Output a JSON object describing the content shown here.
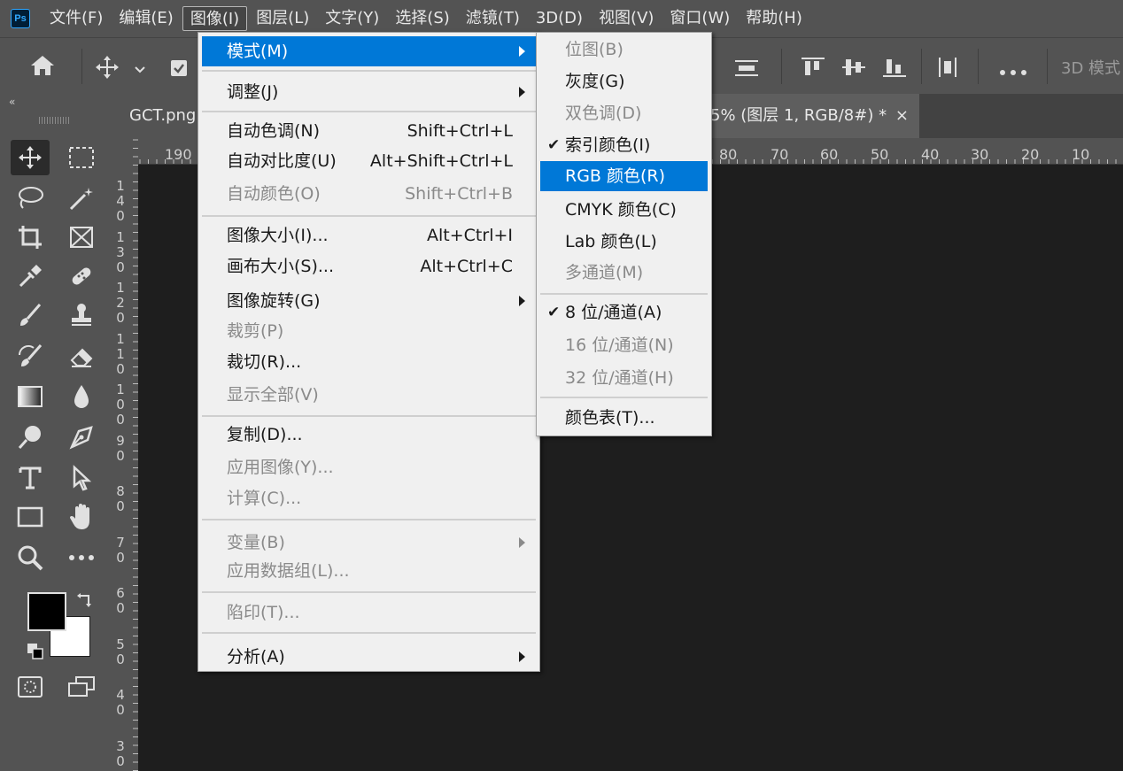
{
  "app": {
    "logo": "Ps"
  },
  "menubar": [
    "文件(F)",
    "编辑(E)",
    "图像(I)",
    "图层(L)",
    "文字(Y)",
    "选择(S)",
    "滤镜(T)",
    "3D(D)",
    "视图(V)",
    "窗口(W)",
    "帮助(H)"
  ],
  "options": {
    "mode_3d": "3D 模式"
  },
  "tabs": {
    "doc1": "GCT.png",
    "doc2_visible": "5% (图层 1, RGB/8#) *",
    "close": "×"
  },
  "hruler": [
    "190",
    "80",
    "70",
    "60",
    "50",
    "40",
    "30",
    "20",
    "10"
  ],
  "vruler": [
    [
      "1",
      "4",
      "0"
    ],
    [
      "1",
      "3",
      "0"
    ],
    [
      "1",
      "2",
      "0"
    ],
    [
      "1",
      "1",
      "0"
    ],
    [
      "1",
      "0",
      "0"
    ],
    [
      "9",
      "0"
    ],
    [
      "8",
      "0"
    ],
    [
      "7",
      "0"
    ],
    [
      "6",
      "0"
    ],
    [
      "5",
      "0"
    ],
    [
      "4",
      "0"
    ],
    [
      "3",
      "0"
    ]
  ],
  "image_menu": [
    {
      "label": "模式(M)",
      "submenu": true,
      "highlighted": true
    },
    {
      "sep": true
    },
    {
      "label": "调整(J)",
      "submenu": true
    },
    {
      "sep": true
    },
    {
      "label": "自动色调(N)",
      "shortcut": "Shift+Ctrl+L"
    },
    {
      "label": "自动对比度(U)",
      "shortcut": "Alt+Shift+Ctrl+L"
    },
    {
      "label": "自动颜色(O)",
      "shortcut": "Shift+Ctrl+B",
      "disabled": true
    },
    {
      "sep": true
    },
    {
      "label": "图像大小(I)...",
      "shortcut": "Alt+Ctrl+I"
    },
    {
      "label": "画布大小(S)...",
      "shortcut": "Alt+Ctrl+C"
    },
    {
      "label": "图像旋转(G)",
      "submenu": true
    },
    {
      "label": "裁剪(P)",
      "disabled": true
    },
    {
      "label": "裁切(R)..."
    },
    {
      "label": "显示全部(V)",
      "disabled": true
    },
    {
      "sep": true
    },
    {
      "label": "复制(D)..."
    },
    {
      "label": "应用图像(Y)...",
      "disabled": true
    },
    {
      "label": "计算(C)...",
      "disabled": true
    },
    {
      "sep": true
    },
    {
      "label": "变量(B)",
      "submenu": true,
      "disabled": true
    },
    {
      "label": "应用数据组(L)...",
      "disabled": true
    },
    {
      "sep": true
    },
    {
      "label": "陷印(T)...",
      "disabled": true
    },
    {
      "sep": true
    },
    {
      "label": "分析(A)",
      "submenu": true
    }
  ],
  "mode_submenu": [
    {
      "label": "位图(B)",
      "disabled": true
    },
    {
      "label": "灰度(G)"
    },
    {
      "label": "双色调(D)",
      "disabled": true
    },
    {
      "label": "索引颜色(I)",
      "checked": true
    },
    {
      "label": "RGB 颜色(R)",
      "highlighted": true
    },
    {
      "label": "CMYK 颜色(C)"
    },
    {
      "label": "Lab 颜色(L)"
    },
    {
      "label": "多通道(M)",
      "disabled": true
    },
    {
      "sep": true
    },
    {
      "label": "8 位/通道(A)",
      "checked": true
    },
    {
      "label": "16 位/通道(N)",
      "disabled": true
    },
    {
      "label": "32 位/通道(H)",
      "disabled": true
    },
    {
      "sep": true
    },
    {
      "label": "颜色表(T)..."
    }
  ],
  "colors": {
    "highlight": "#0078d7",
    "menu_bg": "#f0f0f0",
    "chrome": "#535353"
  }
}
